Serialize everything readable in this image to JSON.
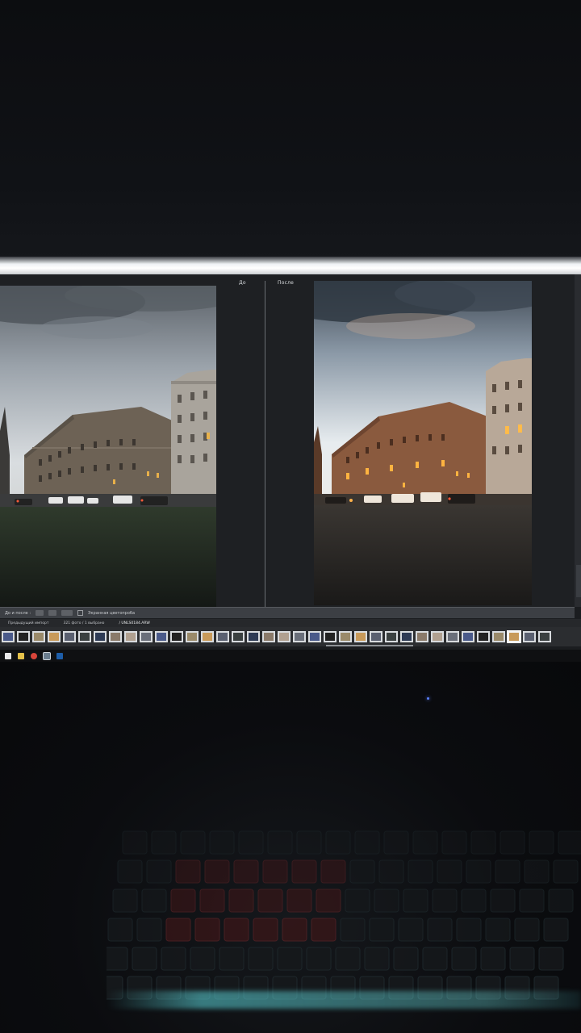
{
  "compare_view": {
    "before_label": "До",
    "after_label": "После"
  },
  "toolbar": {
    "mode_label": "До и после :",
    "softproof_label": "Экранная цветопроба"
  },
  "filmstrip": {
    "source_label": "Предыдущий импорт",
    "count_label": "321 фото / 1 выбрано",
    "current_file": "/ UNLS0184.ARW"
  },
  "colors": {
    "accent_glow": "#eef1f4",
    "keyboard_backlight": "#5ad2d7",
    "led": "#5a7fff"
  }
}
